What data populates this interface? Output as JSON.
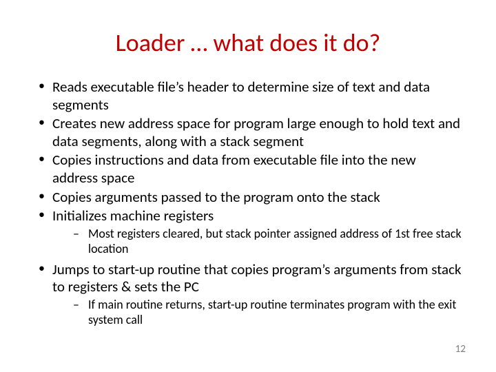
{
  "title": "Loader … what does it do?",
  "bullets": {
    "b0": "Reads executable file’s header to determine size of text and data segments",
    "b1": "Creates new address space for program large enough to hold text and data segments, along with a stack segment",
    "b2": "Copies instructions and data from executable file into the new address space",
    "b3": "Copies arguments passed to the program onto the stack",
    "b4": "Initializes machine registers",
    "b4s": "Most registers cleared, but stack pointer assigned address of 1st free stack location",
    "b5": "Jumps to start-up routine that copies program’s arguments from stack to registers & sets the PC",
    "b5s": "If main routine returns, start-up routine terminates program with the exit system call"
  },
  "page_number": "12"
}
